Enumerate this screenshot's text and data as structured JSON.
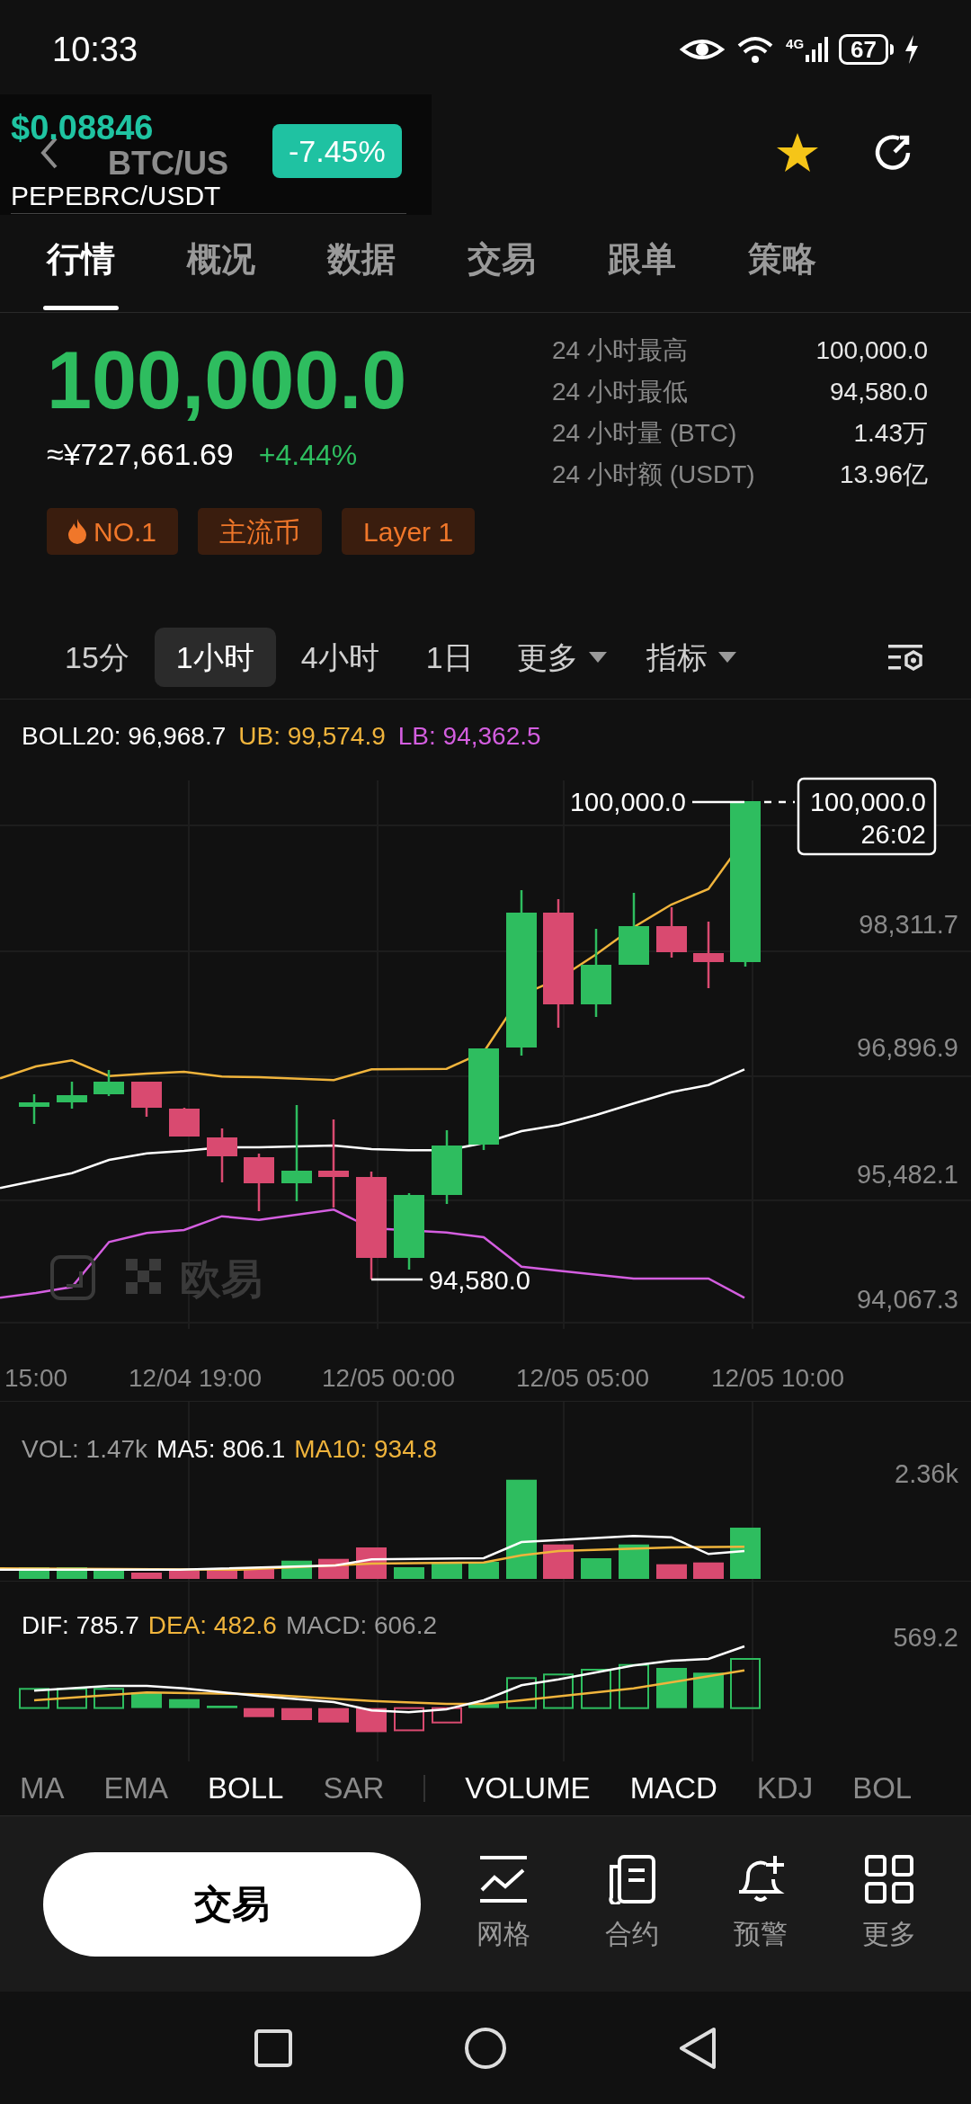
{
  "status_bar": {
    "time": "10:33",
    "network": "4G",
    "battery": "67"
  },
  "header": {
    "title": "BTC/US"
  },
  "floating_ticker": {
    "price": "$0.08846",
    "pair": "PEPEBRC/USDT",
    "change": "-7.45%"
  },
  "tabs": [
    {
      "label": "行情",
      "selected": true
    },
    {
      "label": "概况",
      "selected": false
    },
    {
      "label": "数据",
      "selected": false
    },
    {
      "label": "交易",
      "selected": false
    },
    {
      "label": "跟单",
      "selected": false
    },
    {
      "label": "策略",
      "selected": false
    }
  ],
  "ticker": {
    "price": "100,000.0",
    "cny_price": "≈¥727,661.69",
    "change": "+4.44%",
    "stats": [
      {
        "label": "24 小时最高",
        "value": "100,000.0"
      },
      {
        "label": "24 小时最低",
        "value": "94,580.0"
      },
      {
        "label": "24 小时量 (BTC)",
        "value": "1.43万"
      },
      {
        "label": "24 小时额 (USDT)",
        "value": "13.96亿"
      }
    ],
    "tags": [
      {
        "kind": "hot",
        "label": "NO.1"
      },
      {
        "kind": "plain",
        "label": "主流币"
      },
      {
        "kind": "plain",
        "label": "Layer 1"
      }
    ]
  },
  "intervals": [
    {
      "label": "15分",
      "selected": false
    },
    {
      "label": "1小时",
      "selected": true
    },
    {
      "label": "4小时",
      "selected": false
    },
    {
      "label": "1日",
      "selected": false
    }
  ],
  "menus": [
    {
      "label": "更多"
    },
    {
      "label": "指标"
    }
  ],
  "main_chart": {
    "legend": [
      {
        "label": "BOLL20: 96,968.7",
        "color": "#ffffff"
      },
      {
        "label": "UB: 99,574.9",
        "color": "#f0b43c"
      },
      {
        "label": "LB: 94,362.5",
        "color": "#d45ee0"
      }
    ],
    "high_marker": "100,000.0",
    "current_price": {
      "price": "100,000.0",
      "countdown": "26:02"
    },
    "low_marker": "94,580.0",
    "y_labels": [
      "98,311.7",
      "96,896.9",
      "95,482.1",
      "94,067.3"
    ],
    "x_labels": [
      "15:00",
      "12/04 19:00",
      "12/05 00:00",
      "12/05 05:00",
      "12/05 10:00"
    ],
    "watermark": "欧易"
  },
  "volume_chart": {
    "legend": [
      {
        "label": "VOL: 1.47k",
        "color": "#9a9a9a"
      },
      {
        "label": "MA5: 806.1",
        "color": "#ffffff"
      },
      {
        "label": "MA10: 934.8",
        "color": "#f0b43c"
      }
    ],
    "y_label": "2.36k"
  },
  "macd_chart": {
    "legend": [
      {
        "label": "DIF: 785.7",
        "color": "#ffffff"
      },
      {
        "label": "DEA: 482.6",
        "color": "#f0b43c"
      },
      {
        "label": "MACD: 606.2",
        "color": "#9a9a9a"
      }
    ],
    "y_label": "569.2"
  },
  "main_indicators": [
    {
      "label": "MA",
      "selected": false
    },
    {
      "label": "EMA",
      "selected": false
    },
    {
      "label": "BOLL",
      "selected": true
    },
    {
      "label": "SAR",
      "selected": false
    }
  ],
  "sub_indicators": [
    {
      "label": "VOLUME",
      "selected": true
    },
    {
      "label": "MACD",
      "selected": true
    },
    {
      "label": "KDJ",
      "selected": false
    },
    {
      "label": "BOL",
      "selected": false
    }
  ],
  "bottom_bar": {
    "trade_button": "交易",
    "tools": [
      {
        "kind": "grid",
        "label": "网格"
      },
      {
        "kind": "contract",
        "label": "合约"
      },
      {
        "kind": "alert",
        "label": "预警"
      },
      {
        "kind": "more",
        "label": "更多"
      }
    ]
  }
}
